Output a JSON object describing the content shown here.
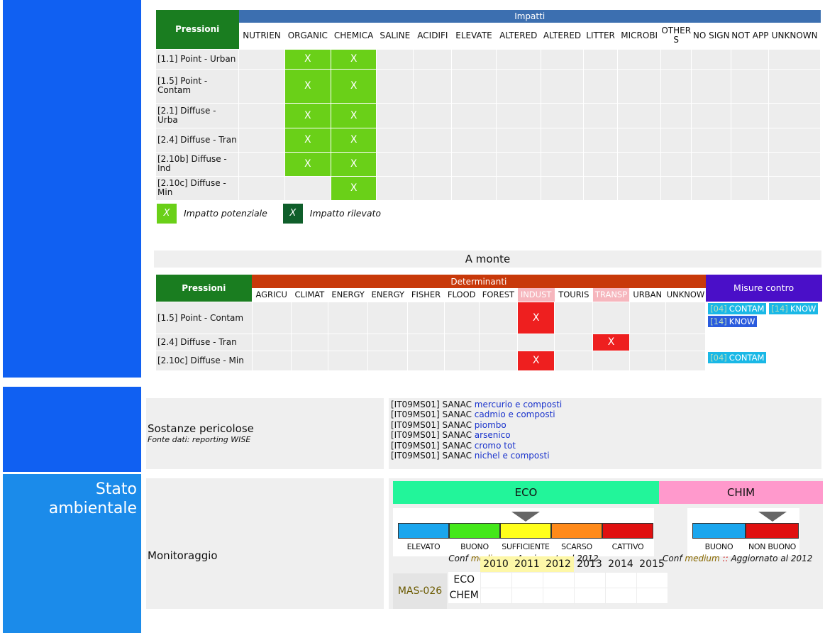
{
  "impacts": {
    "press_header": "Pressioni",
    "group_header": "Impatti",
    "columns": [
      "NUTRIEN",
      "ORGANIC",
      "CHEMICA",
      "SALINE",
      "ACIDIFI",
      "ELEVATE",
      "ALTERED",
      "ALTERED",
      "LITTER",
      "MICROBI",
      "OTHER S",
      "NO SIGN",
      "NOT APP",
      "UNKNOWN"
    ],
    "rows": [
      {
        "label": "[1.1] Point - Urban",
        "cells": [
          "",
          "X",
          "X",
          "",
          "",
          "",
          "",
          "",
          "",
          "",
          "",
          "",
          "",
          ""
        ]
      },
      {
        "label": "[1.5] Point - Contam",
        "cells": [
          "",
          "X",
          "X",
          "",
          "",
          "",
          "",
          "",
          "",
          "",
          "",
          "",
          "",
          ""
        ]
      },
      {
        "label": "[2.1] Diffuse - Urba",
        "cells": [
          "",
          "X",
          "X",
          "",
          "",
          "",
          "",
          "",
          "",
          "",
          "",
          "",
          "",
          ""
        ]
      },
      {
        "label": "[2.4] Diffuse - Tran",
        "cells": [
          "",
          "X",
          "X",
          "",
          "",
          "",
          "",
          "",
          "",
          "",
          "",
          "",
          "",
          ""
        ]
      },
      {
        "label": "[2.10b] Diffuse - Ind",
        "cells": [
          "",
          "X",
          "X",
          "",
          "",
          "",
          "",
          "",
          "",
          "",
          "",
          "",
          "",
          ""
        ]
      },
      {
        "label": "[2.10c] Diffuse - Min",
        "cells": [
          "",
          "",
          "X",
          "",
          "",
          "",
          "",
          "",
          "",
          "",
          "",
          "",
          "",
          ""
        ]
      }
    ],
    "legend_potential_mark": "X",
    "legend_potential": "Impatto potenziale",
    "legend_detected_mark": "X",
    "legend_detected": "Impatto rilevato",
    "color_potential": "#6ad018",
    "color_detected": "#0f5e2a"
  },
  "upstream": {
    "title": "A monte",
    "press_header": "Pressioni",
    "determinants_header": "Determinanti",
    "measures_header": "Misure contro",
    "columns": [
      "AGRICU",
      "CLIMAT",
      "ENERGY",
      "ENERGY",
      "FISHER",
      "FLOOD",
      "FOREST",
      "INDUST",
      "TOURIS",
      "TRANSP",
      "URBAN",
      "UNKNOW"
    ],
    "rows": [
      {
        "label": "[1.5] Point - Contam",
        "cells": [
          "",
          "",
          "",
          "",
          "",
          "",
          "",
          "X",
          "",
          "",
          "",
          ""
        ],
        "measures": [
          {
            "code": "[04]",
            "text": "CONTAM",
            "color": "#1ab8e6"
          },
          {
            "code": "[14]",
            "text": "KNOW",
            "color": "#1ab8e6"
          },
          {
            "code": "[14]",
            "text": "KNOW",
            "color": "#2a5bde"
          }
        ]
      },
      {
        "label": "[2.4] Diffuse - Tran",
        "cells": [
          "",
          "",
          "",
          "",
          "",
          "",
          "",
          "",
          "",
          "X",
          "",
          ""
        ],
        "measures": []
      },
      {
        "label": "[2.10c] Diffuse - Min",
        "cells": [
          "",
          "",
          "",
          "",
          "",
          "",
          "",
          "X",
          "",
          "",
          "",
          ""
        ],
        "measures": [
          {
            "code": "[04]",
            "text": "CONTAM",
            "color": "#1ab8e6"
          }
        ]
      }
    ]
  },
  "hazardous": {
    "title": "Sostanze pericolose",
    "source": "Fonte dati: reporting WISE",
    "items": [
      {
        "prefix": "[IT09MS01] SANAC",
        "name": "mercurio e composti"
      },
      {
        "prefix": "[IT09MS01] SANAC",
        "name": "cadmio e composti"
      },
      {
        "prefix": "[IT09MS01] SANAC",
        "name": "piombo"
      },
      {
        "prefix": "[IT09MS01] SANAC",
        "name": "arsenico"
      },
      {
        "prefix": "[IT09MS01] SANAC",
        "name": "cromo tot"
      },
      {
        "prefix": "[IT09MS01] SANAC",
        "name": "nichel e composti"
      }
    ]
  },
  "status": {
    "side_title_line1": "Stato",
    "side_title_line2": "ambientale",
    "monitor_label": "Monitoraggio",
    "eco": {
      "title": "ECO",
      "color": "#22f59a",
      "classes": [
        {
          "label": "ELEVATO",
          "color": "#1aa6ee"
        },
        {
          "label": "BUONO",
          "color": "#44e81a"
        },
        {
          "label": "SUFFICIENTE",
          "color": "#ffff1a"
        },
        {
          "label": "SCARSO",
          "color": "#ff8a1a"
        },
        {
          "label": "CATTIVO",
          "color": "#e01010"
        }
      ],
      "selected": "SUFFICIENTE",
      "conf_prefix": "Conf",
      "conf_level": "medium",
      "conf_sep": "::",
      "conf_suffix": "Aggiornato al 2012"
    },
    "chim": {
      "title": "CHIM",
      "color": "#ff99cc",
      "classes": [
        {
          "label": "BUONO",
          "color": "#1aa6ee"
        },
        {
          "label": "NON BUONO",
          "color": "#e01010"
        }
      ],
      "selected": "NON BUONO",
      "conf_prefix": "Conf",
      "conf_level": "medium",
      "conf_sep": "::",
      "conf_suffix": "Aggiornato al 2012"
    },
    "station": "MAS-026",
    "years": [
      "2010",
      "2011",
      "2012",
      "2013",
      "2014",
      "2015"
    ],
    "highlight_years": [
      "2010",
      "2011",
      "2012"
    ],
    "rows": [
      "ECO",
      "CHEM"
    ]
  }
}
